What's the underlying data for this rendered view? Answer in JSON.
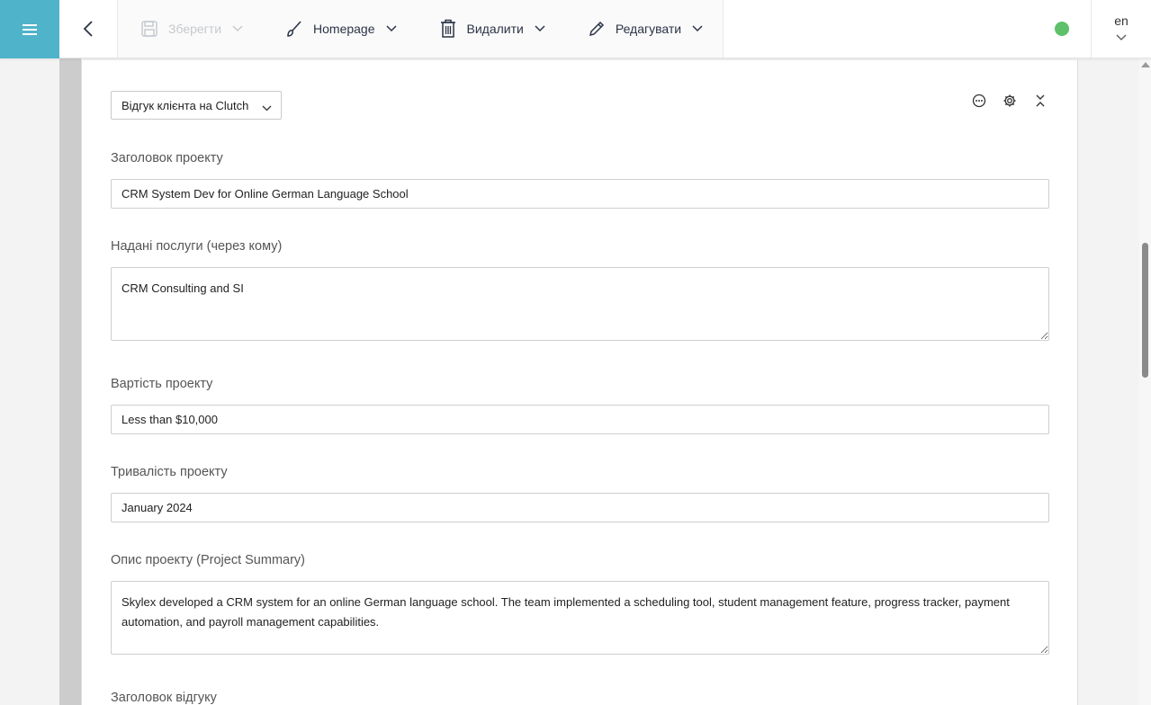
{
  "toolbar": {
    "save_label": "Зберегти",
    "page_label": "Homepage",
    "delete_label": "Видалити",
    "edit_label": "Редагувати",
    "status_color": "#5ec16a",
    "language": "en"
  },
  "block": {
    "type_select": "Відгук клієнта на Clutch"
  },
  "fields": {
    "project_title": {
      "label": "Заголовок проекту",
      "value": "CRM System Dev for Online German Language School"
    },
    "services": {
      "label": "Надані послуги (через кому)",
      "value": "CRM Consulting and SI"
    },
    "cost": {
      "label": "Вартість проекту",
      "value": "Less than $10,000"
    },
    "duration": {
      "label": "Тривалість проекту",
      "value": "January 2024"
    },
    "summary": {
      "label": "Опис проекту (Project Summary)",
      "value": "Skylex developed a CRM system for an online German language school. The team implemented a scheduling tool, student management feature, progress tracker, payment automation, and payroll management capabilities."
    },
    "review_title": {
      "label": "Заголовок відгуку"
    }
  },
  "colors": {
    "menu_accent": "#4fb3c9",
    "left_bar": "#cccccc"
  }
}
